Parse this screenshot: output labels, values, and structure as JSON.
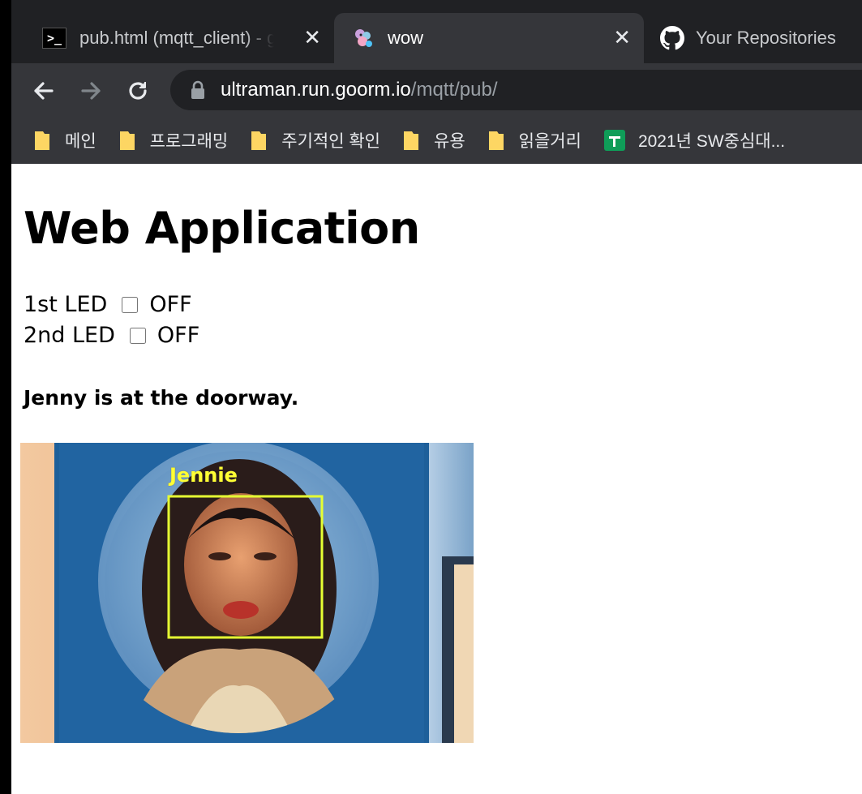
{
  "tabs": [
    {
      "title": "pub.html (mqtt_client) - goorm",
      "icon": "terminal-icon",
      "active": false
    },
    {
      "title": "wow",
      "icon": "wow-favicon-icon",
      "active": true
    },
    {
      "title": "Your Repositories",
      "icon": "github-icon",
      "active": false
    }
  ],
  "close_glyph": "✕",
  "address_bar": {
    "host": "ultraman.run.goorm.io",
    "path": "/mqtt/pub/"
  },
  "bookmarks": [
    {
      "label": "메인",
      "icon": "folder-icon"
    },
    {
      "label": "프로그래밍",
      "icon": "folder-icon"
    },
    {
      "label": "주기적인 확인",
      "icon": "folder-icon"
    },
    {
      "label": "유용",
      "icon": "folder-icon"
    },
    {
      "label": "읽을거리",
      "icon": "folder-icon"
    },
    {
      "label": "2021년 SW중심대...",
      "icon": "google-sheets-icon"
    }
  ],
  "page": {
    "title": "Web Application",
    "leds": [
      {
        "label": "1st LED",
        "state": "OFF",
        "checked": false
      },
      {
        "label": "2nd LED",
        "state": "OFF",
        "checked": false
      }
    ],
    "status_message": "Jenny is at the doorway.",
    "camera": {
      "detection_label": "Jennie",
      "box_color": "#e6ff33"
    }
  },
  "colors": {
    "tabstrip_bg": "#202124",
    "toolbar_bg": "#35363a",
    "omnibox_bg": "#202124"
  }
}
